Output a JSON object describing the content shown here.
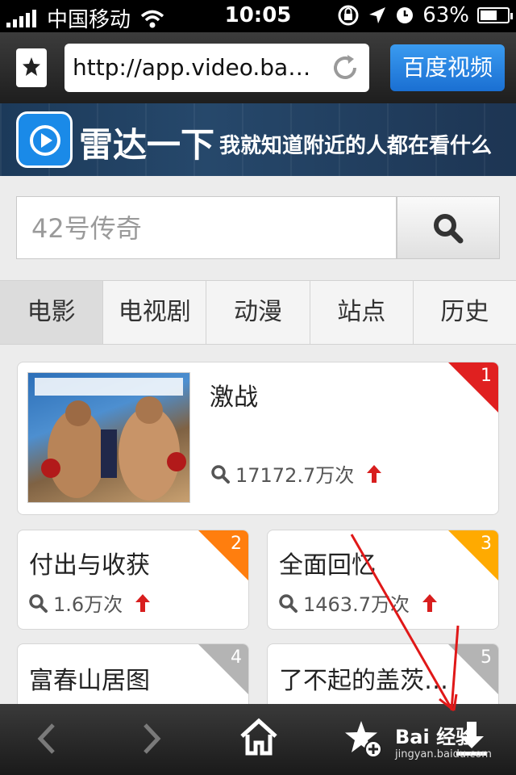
{
  "status_bar": {
    "carrier": "中国移动",
    "time": "10:05",
    "battery": "63%",
    "battery_level": 0.63,
    "icons": [
      "signal-icon",
      "wifi-icon",
      "rotation-lock-icon",
      "location-icon",
      "alarm-icon",
      "battery-icon"
    ]
  },
  "browser": {
    "url": "http://app.video.ba…",
    "site_button": "百度视频",
    "icons": [
      "bookmark-star-icon",
      "reload-icon"
    ]
  },
  "banner": {
    "title": "雷达一下",
    "subtitle": "我就知道附近的人都在看什么"
  },
  "search": {
    "placeholder": "42号传奇"
  },
  "tabs": [
    {
      "label": "电影",
      "active": true
    },
    {
      "label": "电视剧",
      "active": false
    },
    {
      "label": "动漫",
      "active": false
    },
    {
      "label": "站点",
      "active": false
    },
    {
      "label": "历史",
      "active": false
    }
  ],
  "list": [
    {
      "rank": "1",
      "title": "激战",
      "views": "17172.7万次",
      "rank_color": "#e02020"
    },
    {
      "rank": "2",
      "title": "付出与收获",
      "views": "1.6万次",
      "rank_color": "#ff7e0e"
    },
    {
      "rank": "3",
      "title": "全面回忆",
      "views": "1463.7万次",
      "rank_color": "#ffaa00"
    },
    {
      "rank": "4",
      "title": "富春山居图",
      "views": "",
      "rank_color": "#b4b4b4"
    },
    {
      "rank": "5",
      "title": "了不起的盖茨…",
      "views": "",
      "rank_color": "#b4b4b4"
    }
  ],
  "bottom_bar": {
    "icons": [
      "back-icon",
      "forward-icon",
      "home-icon",
      "add-favorite-icon",
      "download-icon"
    ],
    "watermark": "Bai 经验",
    "watermark_url": "jingyan.baidu.com"
  },
  "colors": {
    "accent": "#1a6fd2",
    "trend_up": "#d81e1e"
  }
}
